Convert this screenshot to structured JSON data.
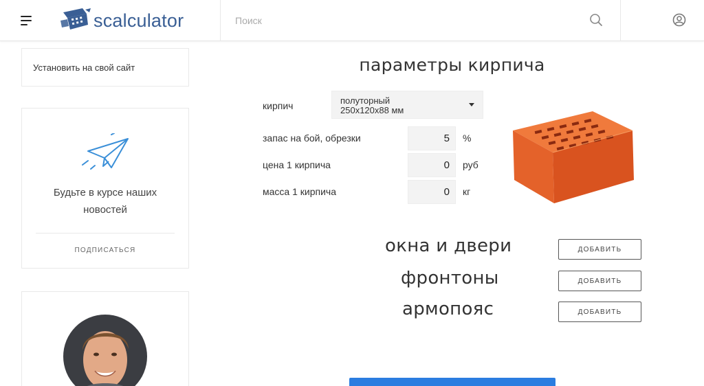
{
  "header": {
    "logo_text": "scalculator",
    "search_placeholder": "Поиск",
    "icons": {
      "menu": "hamburger-menu-icon",
      "search": "search-icon",
      "user": "user-account-icon"
    }
  },
  "sidebar": {
    "install_link": "Установить на свой сайт",
    "news": {
      "icon": "paper-plane-icon",
      "text_line1": "Будьте в курсе наших",
      "text_line2": "новостей",
      "subscribe_label": "ПОДПИСАТЬСЯ"
    },
    "avatar": {
      "icon": "person-photo"
    }
  },
  "main": {
    "title": "параметры кирпича",
    "brick_select": {
      "label": "кирпич",
      "value_line1": "полуторный",
      "value_line2": "250x120x88 мм"
    },
    "fields": [
      {
        "label": "запас на бой, обрезки",
        "value": "5",
        "unit": "%"
      },
      {
        "label": "цена 1 кирпича",
        "value": "0",
        "unit": "руб"
      },
      {
        "label": "масса 1 кирпича",
        "value": "0",
        "unit": "кг"
      }
    ],
    "sections": [
      {
        "title": "окна и двери",
        "button": "ДОБАВИТЬ"
      },
      {
        "title": "фронтоны",
        "button": "ДОБАВИТЬ"
      },
      {
        "title": "армопояс",
        "button": "ДОБАВИТЬ"
      }
    ]
  },
  "colors": {
    "brand": "#3a5f95",
    "accent_blue": "#2b7de0",
    "plane_icon": "#3a8fd8",
    "brick": "#e8642a"
  }
}
